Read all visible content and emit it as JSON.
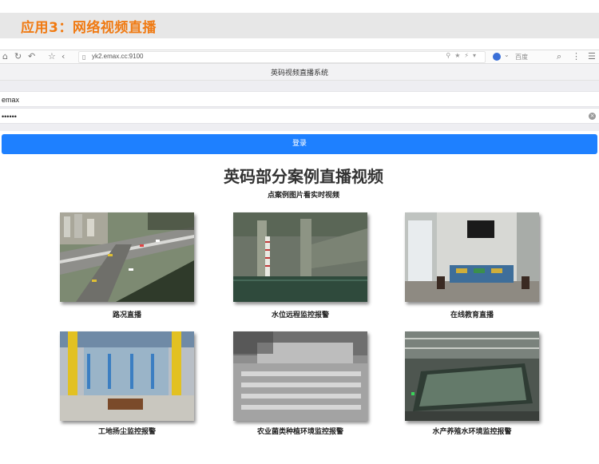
{
  "heading": "应用3：网络视频直播",
  "browser": {
    "url": "yk2.emax.cc:9100",
    "search_engine_label": "百度"
  },
  "app": {
    "system_title": "英码视频直播系统",
    "username_value": "emax",
    "password_value": "••••••",
    "login_label": "登录"
  },
  "cases": {
    "title": "英码部分案例直播视频",
    "subtitle": "点案例图片看实时视频",
    "items": [
      {
        "caption": "路况直播"
      },
      {
        "caption": "水位远程监控报警"
      },
      {
        "caption": "在线教育直播"
      },
      {
        "caption": "工地扬尘监控报警"
      },
      {
        "caption": "农业菌类种植环境监控报警"
      },
      {
        "caption": "水产养殖水环境监控报警"
      }
    ]
  }
}
